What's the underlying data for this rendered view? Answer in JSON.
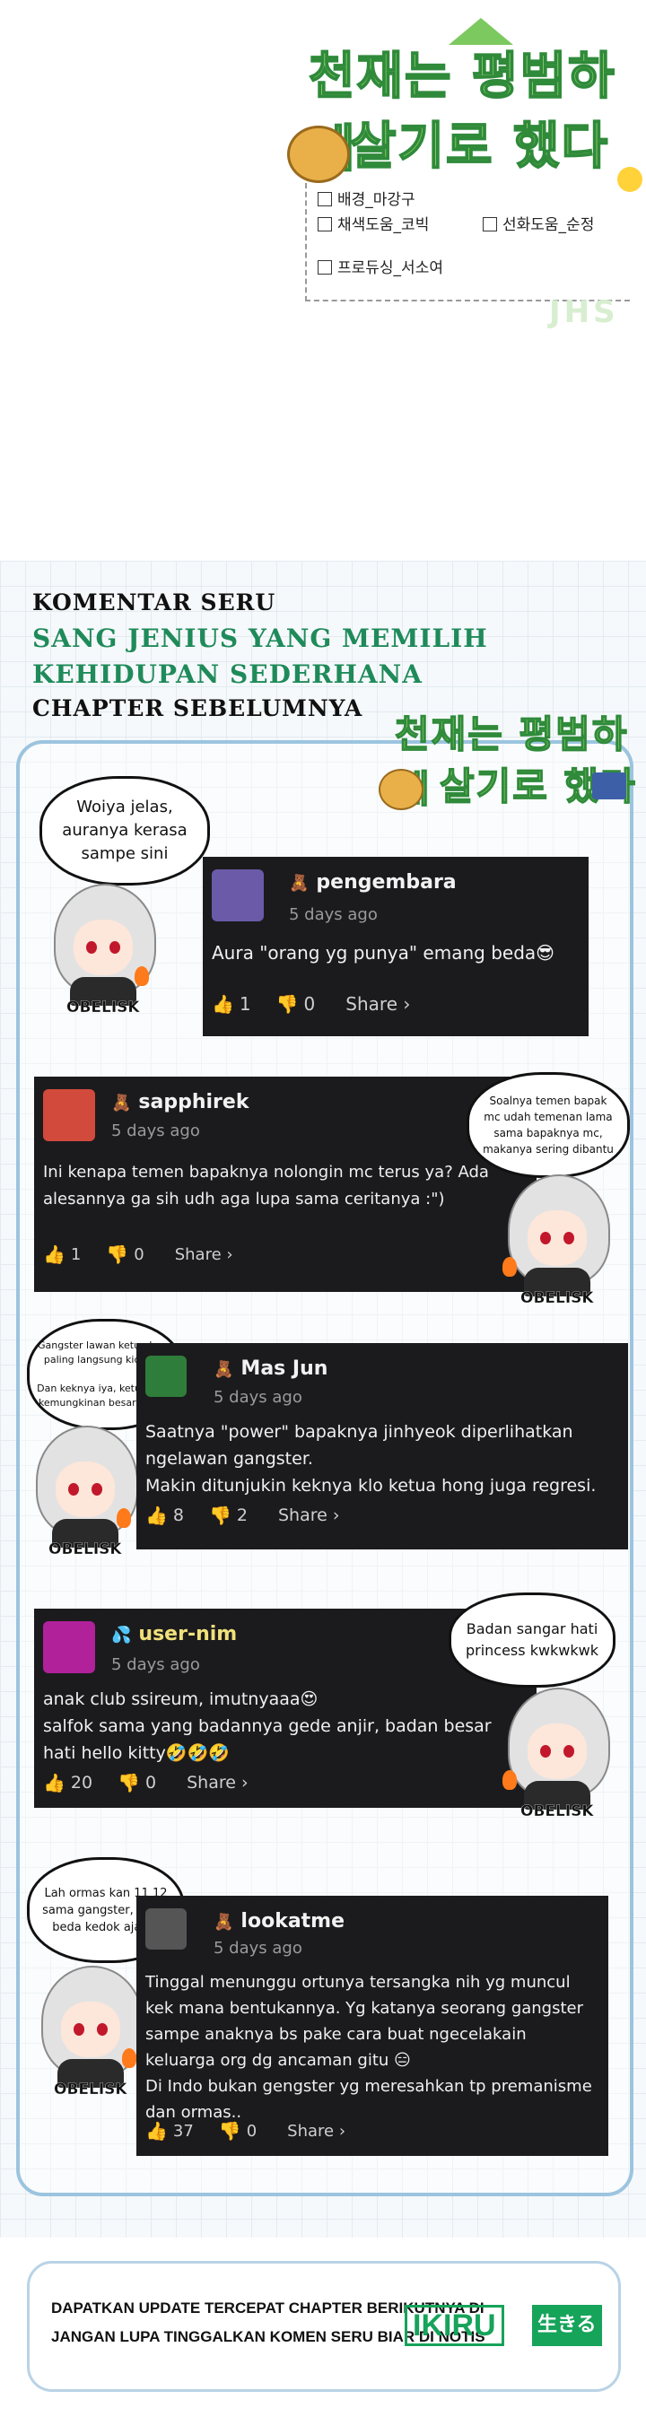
{
  "credits": {
    "logo_line1": "천재는 평범하게",
    "logo_line2": "살기로 했다",
    "items": [
      "배경_마강구",
      "채색도움_코빅",
      "선화도움_순정",
      "프로듀싱_서소여"
    ],
    "studio": "JHS"
  },
  "section": {
    "heading1": "KOMENTAR SERU",
    "heading2": "SANG JENIUS YANG MEMILIH",
    "heading3": "KEHIDUPAN SEDERHANA",
    "heading4": "CHAPTER SEBELUMNYA",
    "mini_logo_line1": "천재는 평범하게",
    "mini_logo_line2": "살기로 했다"
  },
  "comments": [
    {
      "bubble": "Woiya jelas,\nauranya kerasa\nsampe sini",
      "user": "pengembara",
      "badge": "🧸",
      "time": "5 days ago",
      "text": "Aura \"orang yg punya\" emang beda😎",
      "likes": "1",
      "dislikes": "0",
      "share": "Share ›",
      "avatar_color": "#6a5aa8"
    },
    {
      "bubble": "Soalnya temen bapak\nmc udah temenan lama\nsama bapaknya mc,\nmakanya sering dibantu",
      "user": "sapphirek",
      "badge": "🧸",
      "time": "5 days ago",
      "text": "Ini kenapa temen bapaknya nolongin mc terus ya? Ada\nalesannya ga sih udh aga lupa sama ceritanya :\")",
      "likes": "1",
      "dislikes": "0",
      "share": "Share ›",
      "avatar_color": "#d24a3c"
    },
    {
      "bubble": "Gangster lawan ketua hong\npaling langsung kicep itu\n\nDan keknya iya, ketua hong\nkemungkinan besar regresi",
      "user": "Mas Jun",
      "badge": "🧸",
      "time": "5 days ago",
      "text": "Saatnya \"power\" bapaknya jinhyeok diperlihatkan\nngelawan gangster.\nMakin ditunjukin keknya klo ketua hong juga regresi.",
      "likes": "8",
      "dislikes": "2",
      "share": "Share ›",
      "avatar_color": "#2f7d3a"
    },
    {
      "bubble": "Badan sangar hati\nprincess kwkwkwk",
      "user": "user-nim",
      "badge": "💦",
      "time": "5 days ago",
      "text": "anak club ssireum, imutnyaaa😍\nsalfok sama yang badannya gede anjir, badan besar\nhati hello kitty🤣🤣🤣",
      "likes": "20",
      "dislikes": "0",
      "share": "Share ›",
      "avatar_color": "#b0219a"
    },
    {
      "bubble": "Lah ormas kan 11 12\nsama gangster, cuma\nbeda kedok aja 🗿",
      "user": "lookatme",
      "badge": "🧸",
      "time": "5 days ago",
      "text": "Tinggal menunggu ortunya tersangka nih yg muncul\nkek mana bentukannya. Yg katanya seorang gangster\nsampe anaknya bs pake cara buat ngecelakain\nkeluarga org dg ancaman gitu 😑\nDi Indo bukan gengster yg meresahkan tp premanisme\ndan ormas..",
      "likes": "37",
      "dislikes": "0",
      "share": "Share ›",
      "avatar_color": "#555555"
    }
  ],
  "character_tag": "OBELISK",
  "banner": {
    "line1": "DAPATKAN UPDATE TERCEPAT CHAPTER BERIKUTNYA DI",
    "line2": "JANGAN LUPA TINGGALKAN KOMEN SERU BIAR DI NOTIS",
    "brand": "IKIRU",
    "brand_jp": "生きる"
  },
  "colors": {
    "card_bg": "#1b1b1d",
    "accent_green": "#1f8a5a",
    "frame_blue": "#9cc4df"
  }
}
